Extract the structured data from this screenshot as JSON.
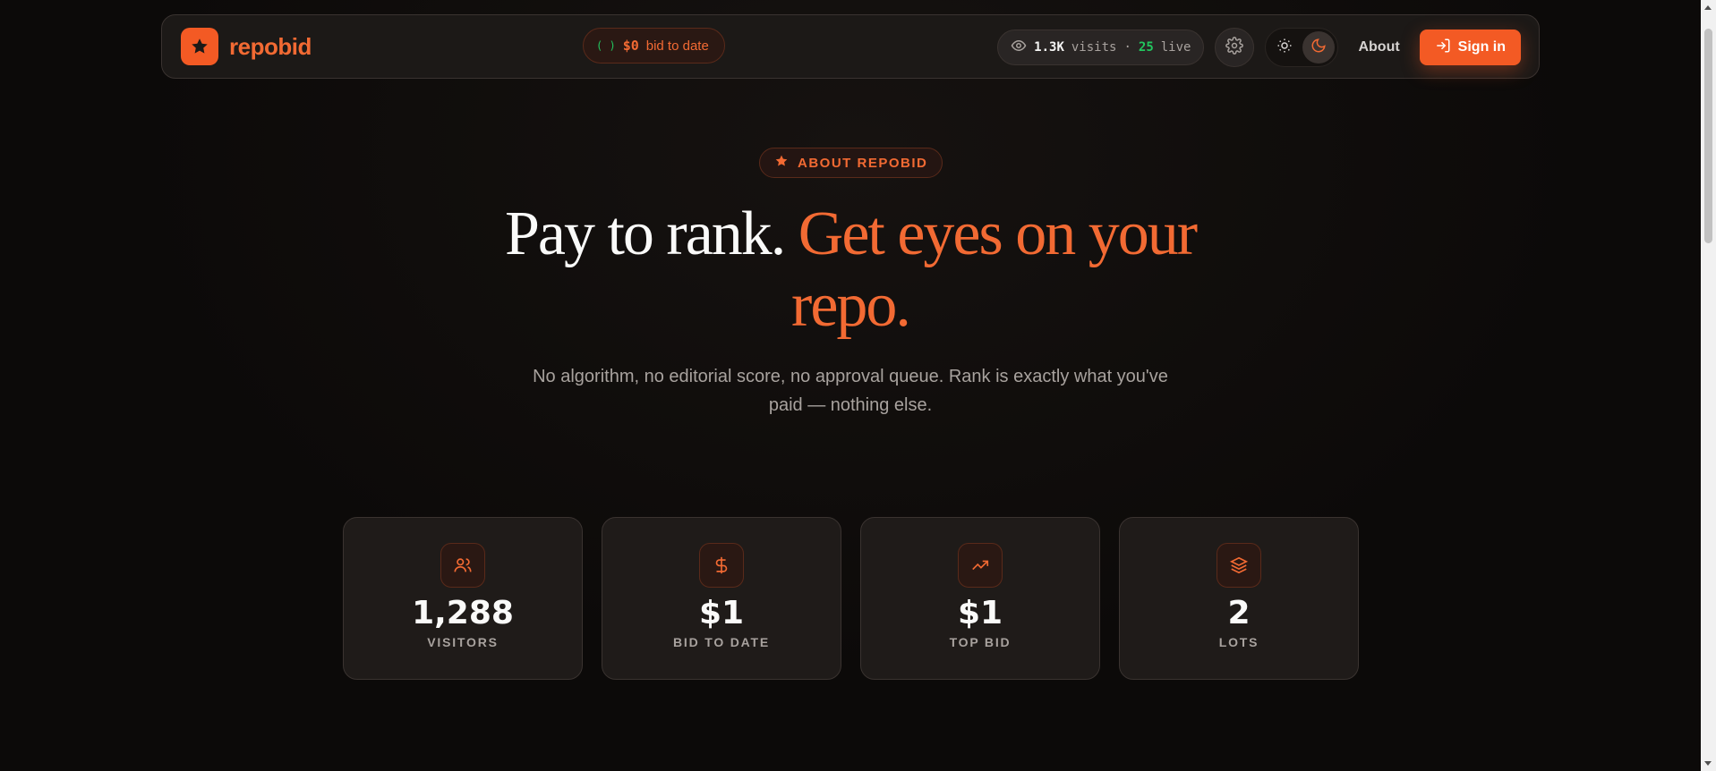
{
  "brand": {
    "name": "repobid"
  },
  "nav": {
    "bid_pill": {
      "spinner": "( )",
      "amount": "$0",
      "label": "bid to date"
    },
    "visits": {
      "count": "1.3K",
      "visits_label": "visits",
      "separator": "·",
      "live_count": "25",
      "live_label": "live"
    },
    "about_label": "About",
    "signin_label": "Sign in"
  },
  "hero": {
    "badge": "ABOUT REPOBID",
    "title_part1": "Pay to rank.",
    "title_part2": "Get eyes on your",
    "title_part3": "repo.",
    "subtitle_line1": "No algorithm, no editorial score, no approval queue. Rank is exactly what you've",
    "subtitle_line2": "paid — nothing else."
  },
  "stats": [
    {
      "icon": "users-icon",
      "value": "1,288",
      "label": "VISITORS"
    },
    {
      "icon": "dollar-icon",
      "value": "$1",
      "label": "BID TO DATE"
    },
    {
      "icon": "trending-up-icon",
      "value": "$1",
      "label": "TOP BID"
    },
    {
      "icon": "layers-icon",
      "value": "2",
      "label": "LOTS"
    }
  ],
  "colors": {
    "accent": "#f35a24",
    "live": "#22c55e",
    "background": "#0c0a09"
  }
}
